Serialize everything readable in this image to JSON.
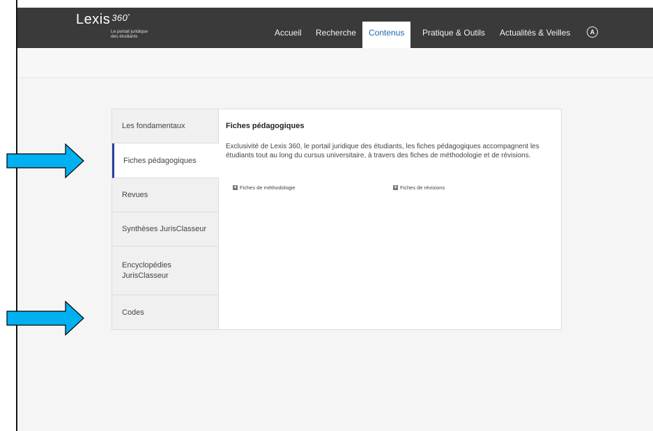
{
  "logo": {
    "name": "Lexis",
    "number": "360",
    "reg": "°",
    "tagline_line1": "Le portail juridique",
    "tagline_line2": "des étudiants"
  },
  "nav": {
    "items": [
      "Accueil",
      "Recherche",
      "Contenus",
      "Pratique & Outils",
      "Actualités & Veilles"
    ],
    "active": "Contenus",
    "user_icon": "user-circle-icon"
  },
  "sidebar": {
    "items": [
      {
        "label": "Les fondamentaux"
      },
      {
        "label": "Fiches pédagogiques"
      },
      {
        "label": "Revues"
      },
      {
        "label": "Synthèses JurisClasseur"
      },
      {
        "label": "Encyclopédies JurisClasseur"
      },
      {
        "label": "Codes"
      }
    ],
    "active": "Fiches pédagogiques"
  },
  "main": {
    "title": "Fiches pédagogiques",
    "description": "Exclusivité de Lexis 360, le portail juridique des étudiants, les fiches pédagogiques accompagnent les étudiants tout au long du cursus universitaire, à travers des fiches de méthodologie et de révisions.",
    "links": [
      "Fiches de méthodologie",
      "Fiches de révisions"
    ],
    "link_icon": "plus-box-icon"
  },
  "colors": {
    "topbar": "#3a3a3a",
    "active_nav_text": "#1a67b0",
    "active_sidebar_border": "#2b3f9c",
    "arrow_fill": "#00b0f0"
  }
}
